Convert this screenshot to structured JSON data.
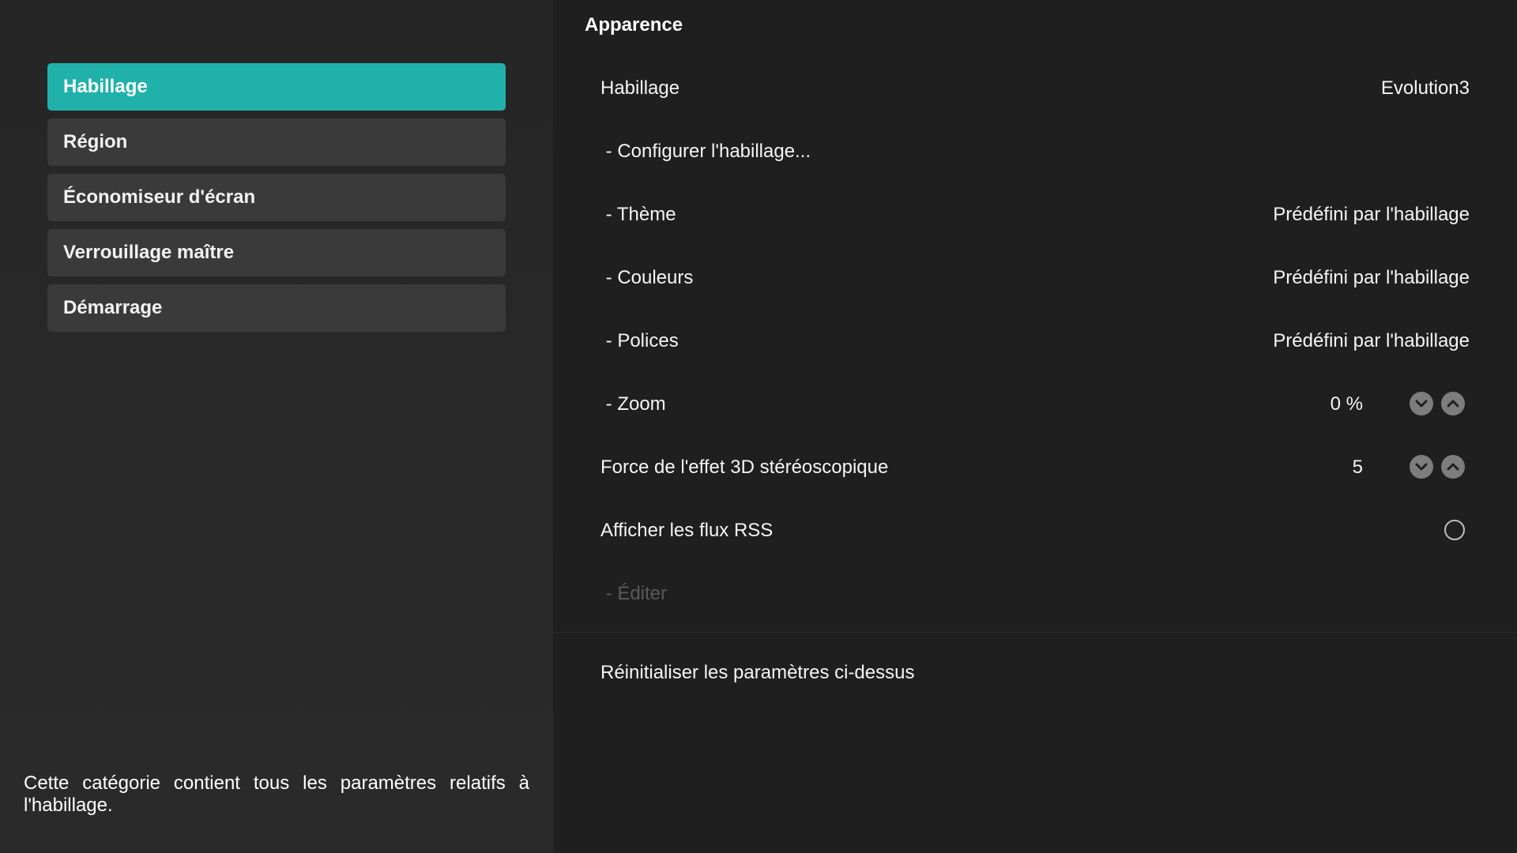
{
  "sidebar": {
    "items": [
      {
        "label": "Habillage"
      },
      {
        "label": "Région"
      },
      {
        "label": "Économiseur d'écran"
      },
      {
        "label": "Verrouillage maître"
      },
      {
        "label": "Démarrage"
      }
    ],
    "active_index": 0,
    "description": "Cette catégorie contient tous les paramètres relatifs à l'habillage."
  },
  "main": {
    "section_title": "Apparence",
    "settings": {
      "skin": {
        "label": "Habillage",
        "value": "Evolution3"
      },
      "configure": {
        "label": " - Configurer l'habillage..."
      },
      "theme": {
        "label": " - Thème",
        "value": "Prédéfini par l'habillage"
      },
      "colors": {
        "label": " - Couleurs",
        "value": "Prédéfini par l'habillage"
      },
      "fonts": {
        "label": " - Polices",
        "value": "Prédéfini par l'habillage"
      },
      "zoom": {
        "label": " - Zoom",
        "value": "0 %"
      },
      "stereo": {
        "label": "Force de l'effet 3D stéréoscopique",
        "value": "5"
      },
      "rss": {
        "label": "Afficher les flux RSS",
        "enabled": false
      },
      "edit": {
        "label": " - Éditer",
        "disabled": true
      }
    },
    "reset_label": "Réinitialiser les paramètres ci-dessus"
  },
  "colors": {
    "accent": "#20b2aa",
    "background": "#1f1f1f",
    "sidebar_item": "#3a3a3a"
  },
  "icons": {
    "spin_down": "chevron-down-icon",
    "spin_up": "chevron-up-icon",
    "radio": "radio-off-icon"
  }
}
